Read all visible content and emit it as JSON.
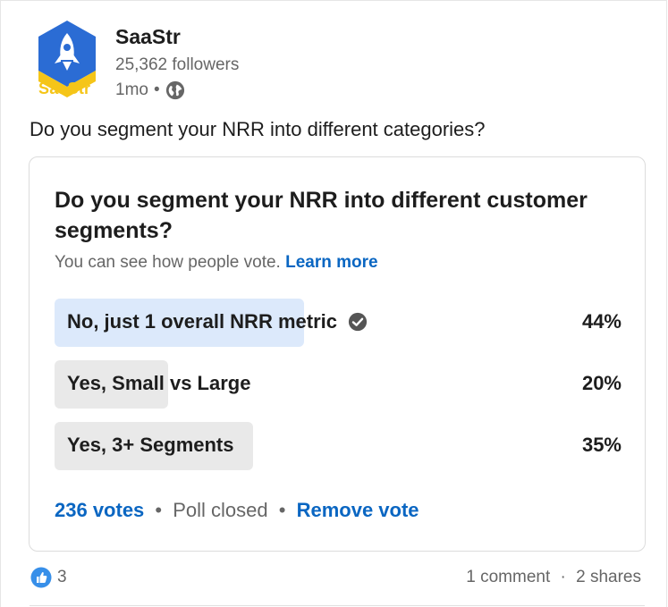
{
  "author": {
    "logo_word": "SaaStr",
    "name": "SaaStr",
    "followers": "25,362 followers",
    "time": "1mo",
    "separator": "•",
    "visibility_icon": "globe-icon"
  },
  "post": {
    "text": "Do you segment your NRR into different categories?"
  },
  "poll": {
    "question": "Do you segment your NRR into different customer segments?",
    "subtitle": "You can see how people vote.",
    "learn_more": "Learn more",
    "options": [
      {
        "label": "No, just 1 overall NRR metric",
        "percent_label": "44%",
        "percent": 44,
        "selected": true
      },
      {
        "label": "Yes, Small vs Large",
        "percent_label": "20%",
        "percent": 20,
        "selected": false
      },
      {
        "label": "Yes, 3+ Segments",
        "percent_label": "35%",
        "percent": 35,
        "selected": false
      }
    ],
    "votes": "236 votes",
    "status": "Poll closed",
    "remove_vote": "Remove vote",
    "dot": "•"
  },
  "social": {
    "reaction_icon": "like-icon",
    "reaction_count": "3",
    "comments": "1 comment",
    "shares": "2 shares",
    "dot": "·"
  },
  "colors": {
    "accent": "#0a66c2",
    "selected_fill": "#dce9fb",
    "option_fill": "#e9e9e9",
    "logo_blue": "#2b6cd4",
    "logo_yellow": "#f5c518"
  }
}
